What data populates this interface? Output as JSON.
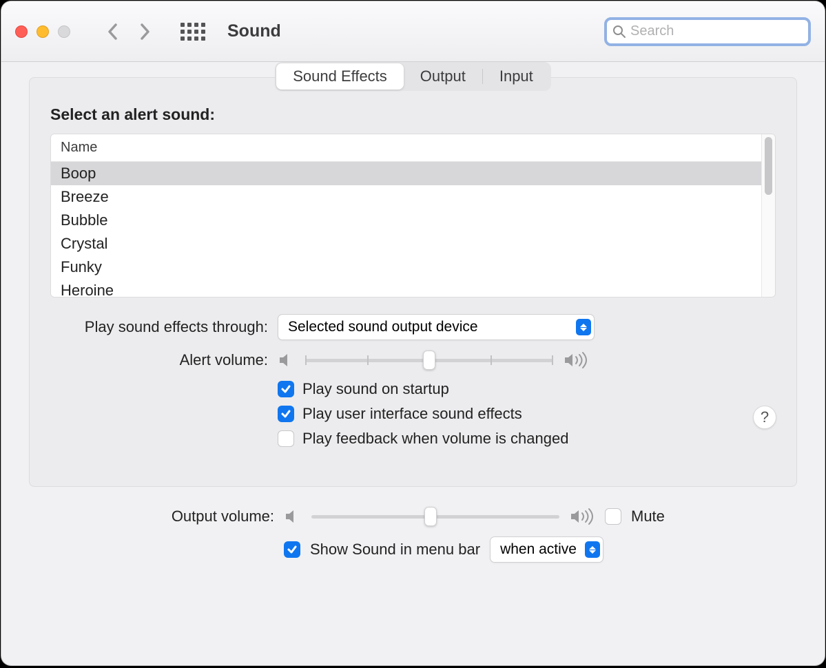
{
  "window": {
    "title": "Sound"
  },
  "search": {
    "placeholder": "Search"
  },
  "tabs": {
    "soundEffects": "Sound Effects",
    "output": "Output",
    "input": "Input",
    "active": "Sound Effects"
  },
  "alertSounds": {
    "heading": "Select an alert sound:",
    "columnHeader": "Name",
    "items": [
      "Boop",
      "Breeze",
      "Bubble",
      "Crystal",
      "Funky",
      "Heroine"
    ],
    "selected": "Boop"
  },
  "playThrough": {
    "label": "Play sound effects through:",
    "value": "Selected sound output device"
  },
  "alertVolume": {
    "label": "Alert volume:",
    "percent": 50
  },
  "checks": {
    "startup": {
      "label": "Play sound on startup",
      "checked": true
    },
    "uiSounds": {
      "label": "Play user interface sound effects",
      "checked": true
    },
    "feedback": {
      "label": "Play feedback when volume is changed",
      "checked": false
    }
  },
  "outputVolume": {
    "label": "Output volume:",
    "percent": 48
  },
  "mute": {
    "label": "Mute",
    "checked": false
  },
  "menubar": {
    "label": "Show Sound in menu bar",
    "checked": true,
    "mode": "when active"
  },
  "helpTooltip": "?"
}
